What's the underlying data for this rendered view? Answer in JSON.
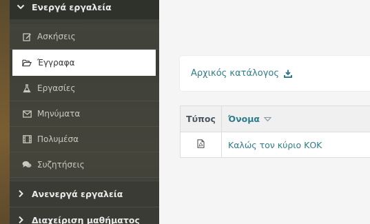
{
  "sidebar": {
    "active_tools_label": "Ενεργά εργαλεία",
    "items": [
      {
        "label": "Ασκήσεις",
        "icon": "edit-icon"
      },
      {
        "label": "Έγγραφα",
        "icon": "folder-open-icon"
      },
      {
        "label": "Εργασίες",
        "icon": "flask-icon"
      },
      {
        "label": "Μηνύματα",
        "icon": "envelope-icon"
      },
      {
        "label": "Πολυμέσα",
        "icon": "film-icon"
      },
      {
        "label": "Συζητήσεις",
        "icon": "comments-icon"
      }
    ],
    "inactive_tools_label": "Ανενεργά εργαλεία",
    "course_admin_label": "Διαχείριση μαθήματος"
  },
  "main": {
    "breadcrumb": {
      "root_label": "Αρχικός κατάλογος",
      "icon": "download-icon"
    },
    "table": {
      "headers": {
        "type": "Τύπος",
        "name": "Όνομα"
      },
      "rows": [
        {
          "type_icon": "pdf-file-icon",
          "name": "Καλώς τον κύριο ΚΟΚ"
        }
      ]
    }
  },
  "colors": {
    "accent": "#2f7d8c",
    "sidebar_bg": "#3f4239",
    "active_bg": "#ffffff"
  }
}
